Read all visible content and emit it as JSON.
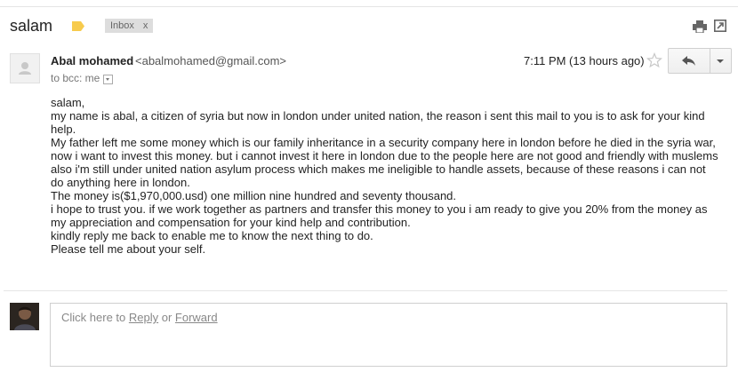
{
  "thread": {
    "subject": "salam",
    "label_chip": "Inbox",
    "label_remove": "x"
  },
  "message": {
    "sender_name": "Abal mohamed",
    "sender_email": "<abalmohamed@gmail.com>",
    "to_line": "to bcc: me",
    "timestamp": "7:11 PM (13 hours ago)",
    "body_lines": [
      "salam,",
      "my name is abal, a citizen of syria but now in london under united nation, the reason i sent this mail to you is to ask for your kind help.",
      "My father left me some money which is our family inheritance in a security company here in london before he died in the syria war,",
      "now i want to invest this money. but i cannot invest it here in london due to the people here are not good and friendly with muslems also i'm still under united nation asylum process which makes me ineligible to handle assets, because of these reasons i can not do anything here in london.",
      "The money is($1,970,000.usd)  one million nine hundred and seventy thousand.",
      "i hope to trust you. if we work together as partners and transfer this money to you i am ready to give you 20% from the money as my appreciation and compensation for your kind help and contribution.",
      "kindly reply me back to enable me to know the next thing to do.",
      "Please tell me about your self."
    ]
  },
  "reply_box": {
    "prefix": "Click here to ",
    "reply_link": "Reply",
    "or_text": " or ",
    "forward_link": "Forward"
  },
  "icons": {
    "label_tag": "label-tag-icon",
    "print": "print-icon",
    "new_window": "new-window-icon",
    "star": "star-icon",
    "reply": "reply-arrow-icon",
    "more": "chevron-down-icon"
  },
  "colors": {
    "label_tag": "#f7cb4d",
    "chip_bg": "#dddddd"
  }
}
